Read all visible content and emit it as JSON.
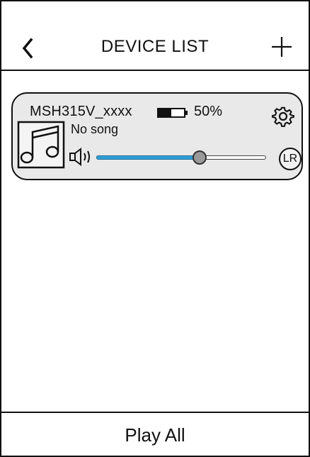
{
  "header": {
    "back_icon": "chevron-left-icon",
    "title": "DEVICE LIST",
    "add_icon": "plus-icon"
  },
  "device": {
    "name": "MSH315V_xxxx",
    "battery_percent": 50,
    "battery_label": "50%",
    "settings_icon": "gear-icon",
    "album_icon": "music-note-icon",
    "song": "No song",
    "speaker_icon": "speaker-icon",
    "volume_fraction": 0.61,
    "channel_label": "LR"
  },
  "footer": {
    "play_all_label": "Play All"
  },
  "colors": {
    "card_background": "#e9e9e9",
    "slider_fill": "#2f9fd8",
    "slider_thumb": "#9a9a9a",
    "border": "#111111"
  }
}
